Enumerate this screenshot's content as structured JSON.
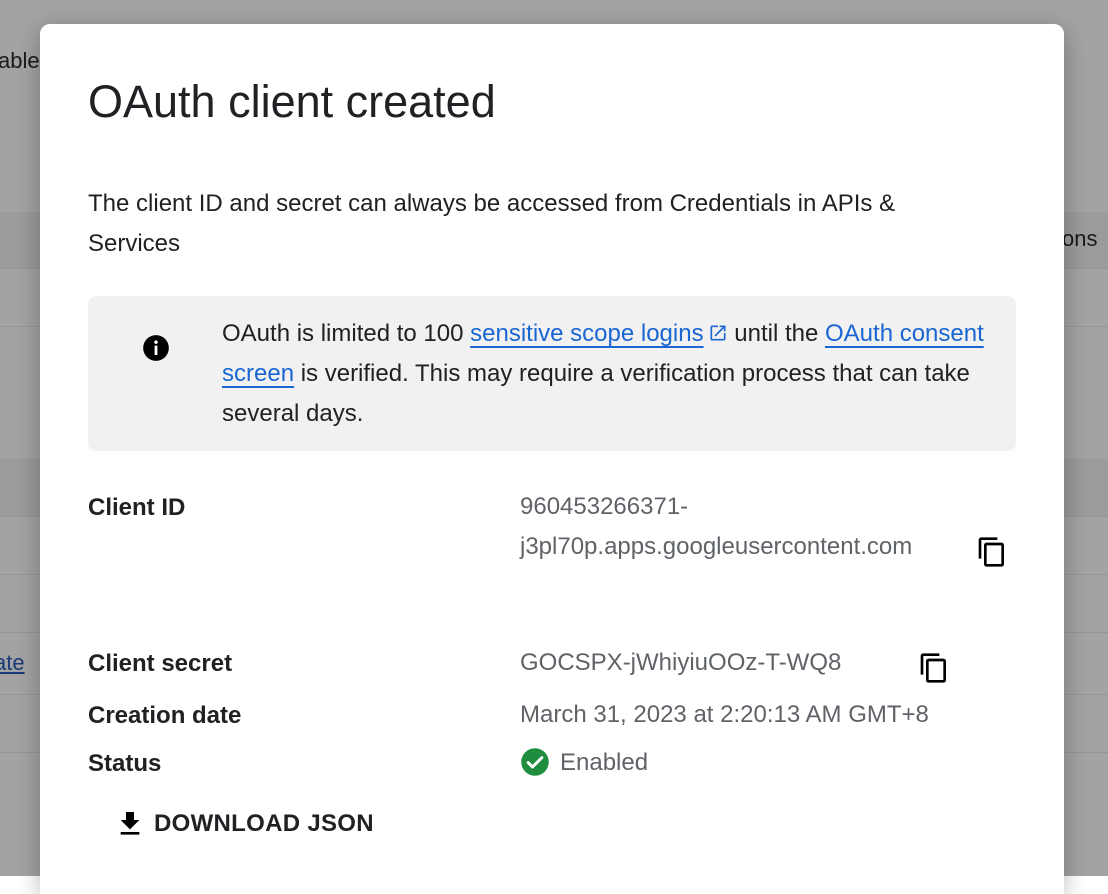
{
  "background": {
    "left_fragment_top": "able",
    "right_fragment_header": "ons",
    "left_link_fragment": "ate"
  },
  "dialog": {
    "title": "OAuth client created",
    "description": "The client ID and secret can always be accessed from Credentials in APIs & Services",
    "notice": {
      "icon": "info-icon",
      "text_before": "OAuth is limited to 100 ",
      "link1_label": "sensitive scope logins",
      "text_middle": " until the ",
      "link2_label": "OAuth consent screen",
      "text_after": " is verified. This may require a verification process that can take several days."
    },
    "fields": {
      "client_id_label": "Client ID",
      "client_id_line1": "960453266371-",
      "client_id_line2": "j3pl70p.apps.googleusercontent.com",
      "client_secret_label": "Client secret",
      "client_secret_value": "GOCSPX-jWhiyiuOOz-T-WQ8",
      "creation_date_label": "Creation date",
      "creation_date_value": "March 31, 2023 at 2:20:13 AM GMT+8",
      "status_label": "Status",
      "status_value": "Enabled"
    },
    "download_label": "DOWNLOAD JSON"
  },
  "colors": {
    "link": "#1a66d2",
    "status_green": "#1e8e3e",
    "notice_bg": "#f1f1f1"
  }
}
